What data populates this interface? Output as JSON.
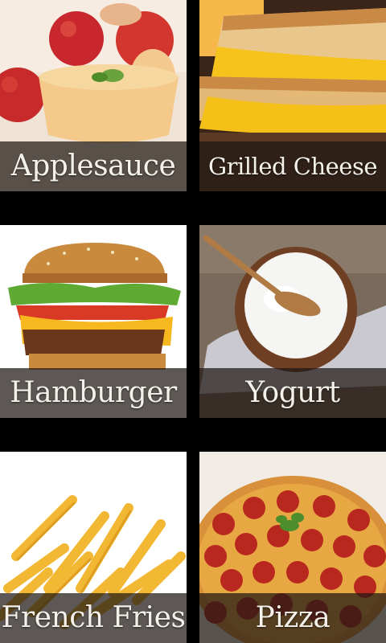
{
  "foods": [
    {
      "label": "Applesauce",
      "icon": "applesauce-photo"
    },
    {
      "label": "Grilled Cheese",
      "icon": "grilled-cheese-photo"
    },
    {
      "label": "Hamburger",
      "icon": "hamburger-photo"
    },
    {
      "label": "Yogurt",
      "icon": "yogurt-photo"
    },
    {
      "label": "French Fries",
      "icon": "french-fries-photo"
    },
    {
      "label": "Pizza",
      "icon": "pizza-photo"
    }
  ],
  "colors": {
    "background": "#000000",
    "caption_overlay": "#1e1814",
    "caption_text": "#f4f1ea"
  }
}
